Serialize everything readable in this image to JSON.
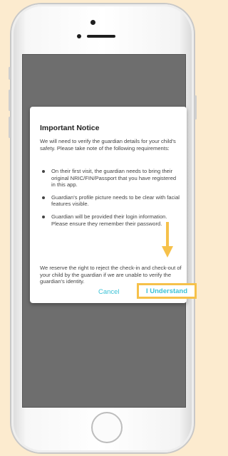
{
  "dialog": {
    "title": "Important Notice",
    "intro": "We will need to verify the guardian details for your child's safety. Please take note of the following requirements:",
    "bullets": [
      "On their first visit, the guardian needs to bring their original NRIC/FIN/Passport that you have registered in this app.",
      "Guardian's profile picture needs to be clear with facial features visible.",
      "Guardian will be provided their login information. Please ensure they remember their password."
    ],
    "footer": "We reserve the right to reject the check-in and check-out of your child by the guardian if we are unable to verify the guardian's identity.",
    "cancel_label": "Cancel",
    "confirm_label": "I Understand"
  },
  "colors": {
    "accent": "#3cc2d6",
    "highlight": "#f6c14a",
    "overlay": "#6e6e6e",
    "background": "#fcebcf"
  },
  "icons": {
    "indicator": "down-arrow-icon"
  }
}
